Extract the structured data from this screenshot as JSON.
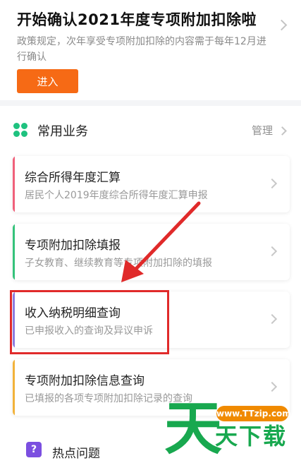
{
  "banner": {
    "title": "开始确认2021年度专项附加扣除啦",
    "description": "政策规定，次年享受专项附加扣除的内容需于每年12月进行确认",
    "enter_label": "进入"
  },
  "services": {
    "title": "常用业务",
    "manage_label": "管理",
    "items": [
      {
        "title": "综合所得年度汇算",
        "subtitle": "居民个人2019年度综合所得年度汇算申报",
        "accent": "#f0607a"
      },
      {
        "title": "专项附加扣除填报",
        "subtitle": "子女教育、继续教育等专项附加扣除的填报",
        "accent": "#34c27a"
      },
      {
        "title": "收入纳税明细查询",
        "subtitle": "已申报收入的查询及异议申诉",
        "accent": "#8b7be0"
      },
      {
        "title": "专项附加扣除信息查询",
        "subtitle": "已填报的各项专项附加扣除记录的查询",
        "accent": "#f2b23a"
      }
    ]
  },
  "hot": {
    "icon_text": "?",
    "label": "热点问题"
  },
  "watermark": {
    "url": "www.TTzip.com",
    "big": "天",
    "small": "天下载"
  },
  "colors": {
    "primary_button": "#f66a15",
    "annotation": "#e02a2a",
    "clover": "#1fc27f",
    "watermark_green": "#18a84f"
  }
}
